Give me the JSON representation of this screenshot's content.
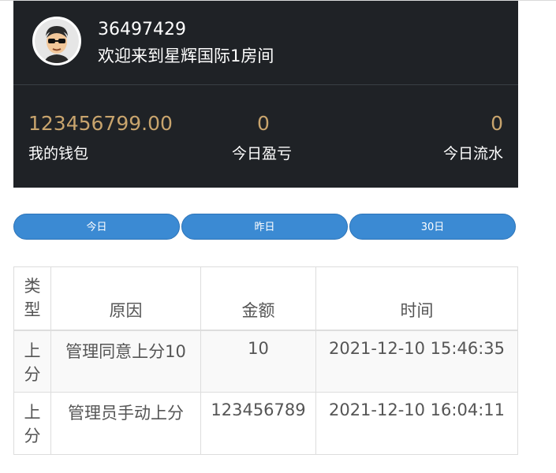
{
  "header": {
    "user_id": "36497429",
    "welcome": "欢迎来到星辉国际1房间"
  },
  "stats": [
    {
      "value": "123456799.00",
      "label": "我的钱包"
    },
    {
      "value": "0",
      "label": "今日盈亏"
    },
    {
      "value": "0",
      "label": "今日流水"
    }
  ],
  "tabs": [
    "今日",
    "昨日",
    "30日"
  ],
  "table": {
    "headers": [
      "类\n型",
      "原因",
      "金额",
      "时间"
    ],
    "rows": [
      [
        "上\n分",
        "管理同意上分10",
        "10",
        "2021-12-10 15:46:35"
      ],
      [
        "上\n分",
        "管理员手动上分",
        "123456789",
        "2021-12-10 16:04:11"
      ]
    ]
  },
  "colors": {
    "panel_bg": "#1f2226",
    "accent_gold": "#c8a46d",
    "tab_blue": "#3b8ad3"
  },
  "icons": {
    "avatar": "cartoon-face-with-sunglasses-icon"
  }
}
